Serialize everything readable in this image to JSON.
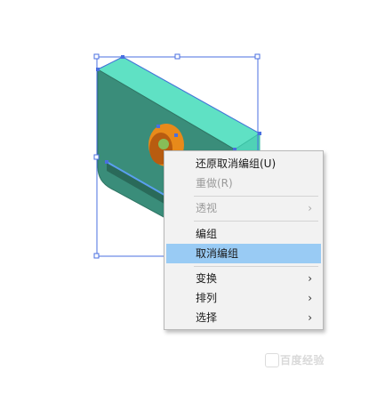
{
  "context_menu": {
    "items": [
      {
        "label": "还原取消编组(U)",
        "enabled": true,
        "submenu": false
      },
      {
        "label": "重做(R)",
        "enabled": false,
        "submenu": false
      },
      {
        "label": "透视",
        "enabled": false,
        "submenu": true
      },
      {
        "label": "编组",
        "enabled": true,
        "submenu": false
      },
      {
        "label": "取消编组",
        "enabled": true,
        "submenu": false,
        "highlighted": true
      },
      {
        "label": "变换",
        "enabled": true,
        "submenu": true
      },
      {
        "label": "排列",
        "enabled": true,
        "submenu": true
      },
      {
        "label": "选择",
        "enabled": true,
        "submenu": true
      }
    ],
    "submenu_arrow": "›"
  },
  "watermark": {
    "text": "百度经验"
  },
  "colors": {
    "object_front": "#3a8d7a",
    "object_top": "#5fe1c4",
    "hole_orange": "#e88a1a",
    "selection_blue": "#4a6fe0",
    "menu_highlight": "#99cbf4"
  },
  "icons": [
    "submenu-arrow-icon",
    "watermark-badge-icon"
  ]
}
